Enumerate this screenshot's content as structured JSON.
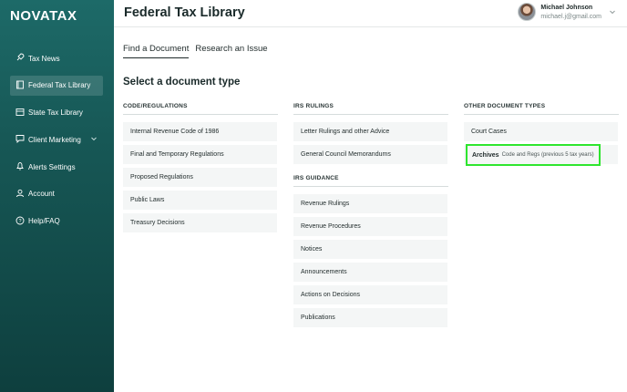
{
  "brand": {
    "logo": "NOVATAX"
  },
  "sidebar": {
    "items": [
      {
        "label": "Tax News",
        "icon": "rocket-icon"
      },
      {
        "label": "Federal Tax Library",
        "icon": "book-icon",
        "active": true
      },
      {
        "label": "State Tax Library",
        "icon": "library-icon"
      },
      {
        "label": "Client Marketing",
        "icon": "chat-icon",
        "has_submenu": true
      },
      {
        "label": "Alerts Settings",
        "icon": "bell-icon"
      },
      {
        "label": "Account",
        "icon": "user-icon"
      },
      {
        "label": "Help/FAQ",
        "icon": "help-icon"
      }
    ]
  },
  "header": {
    "title": "Federal Tax Library",
    "user": {
      "name": "Michael Johnson",
      "email": "michael.j@gmail.com"
    }
  },
  "tabs": [
    {
      "label": "Find a Document",
      "active": true
    },
    {
      "label": "Research an Issue",
      "active": false
    }
  ],
  "main": {
    "section_title": "Select a document type",
    "code_regulations": {
      "heading": "CODE/REGULATIONS",
      "items": [
        "Internal Revenue Code of 1986",
        "Final and Temporary Regulations",
        "Proposed Regulations",
        "Public Laws",
        "Treasury Decisions"
      ]
    },
    "irs_rulings": {
      "heading": "IRS RULINGS",
      "items": [
        "Letter Rulings and other Advice",
        "General Council Memorandums"
      ]
    },
    "irs_guidance": {
      "heading": "IRS GUIDANCE",
      "items": [
        "Revenue Rulings",
        "Revenue Procedures",
        "Notices",
        "Announcements",
        "Actions on Decisions",
        "Publications"
      ]
    },
    "other_types": {
      "heading": "OTHER DOCUMENT TYPES",
      "court_cases": "Court Cases",
      "archives_label": "Archives",
      "archives_sub": "Code and Regs (previous 5 tax years)"
    }
  },
  "colors": {
    "sidebar": "#175856",
    "highlight": "#2ee52e",
    "doc_bg": "#f4f6f6"
  }
}
